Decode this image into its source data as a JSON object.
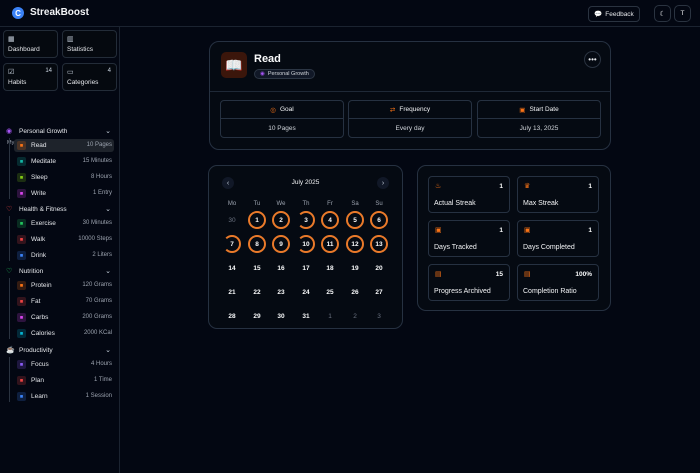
{
  "app": {
    "name": "StreakBoost",
    "feedback": "Feedback",
    "user_initial": "T",
    "theme_icon": "moon-icon"
  },
  "sidebar": {
    "cards": [
      {
        "label": "Dashboard",
        "count": ""
      },
      {
        "label": "Statistics",
        "count": ""
      },
      {
        "label": "Habits",
        "count": "14"
      },
      {
        "label": "Categories",
        "count": "4"
      }
    ],
    "section_title": "My Habits",
    "groups": [
      {
        "name": "Personal Growth",
        "color": "#a855f7",
        "items": [
          {
            "name": "Read",
            "value": "10 Pages",
            "color": "#f97316"
          },
          {
            "name": "Meditate",
            "value": "15 Minutes",
            "color": "#14b8a6"
          },
          {
            "name": "Sleep",
            "value": "8 Hours",
            "color": "#84cc16"
          },
          {
            "name": "Write",
            "value": "1 Entry",
            "color": "#d946ef"
          }
        ]
      },
      {
        "name": "Health & Fitness",
        "color": "#ef4444",
        "items": [
          {
            "name": "Exercise",
            "value": "30 Minutes",
            "color": "#22c55e"
          },
          {
            "name": "Walk",
            "value": "10000 Steps",
            "color": "#ef4444"
          },
          {
            "name": "Drink",
            "value": "2 Liters",
            "color": "#3b82f6"
          }
        ]
      },
      {
        "name": "Nutrition",
        "color": "#22c55e",
        "items": [
          {
            "name": "Protein",
            "value": "120 Grams",
            "color": "#f97316"
          },
          {
            "name": "Fat",
            "value": "70 Grams",
            "color": "#ef4444"
          },
          {
            "name": "Carbs",
            "value": "200 Grams",
            "color": "#d946ef"
          },
          {
            "name": "Calories",
            "value": "2000 KCal",
            "color": "#06b6d4"
          }
        ]
      },
      {
        "name": "Productivity",
        "color": "#eab308",
        "items": [
          {
            "name": "Focus",
            "value": "4 Hours",
            "color": "#8b5cf6"
          },
          {
            "name": "Plan",
            "value": "1 Time",
            "color": "#ef4444"
          },
          {
            "name": "Learn",
            "value": "1 Session",
            "color": "#3b82f6"
          }
        ]
      }
    ]
  },
  "habit": {
    "title": "Read",
    "category": "Personal Growth",
    "menu": "•••",
    "info": [
      {
        "label": "Goal",
        "value": "10 Pages",
        "icon": "target-icon"
      },
      {
        "label": "Frequency",
        "value": "Every day",
        "icon": "repeat-icon"
      },
      {
        "label": "Start Date",
        "value": "July 13, 2025",
        "icon": "calendar-icon"
      }
    ]
  },
  "calendar": {
    "month": "July 2025",
    "prev": "‹",
    "next": "›",
    "weekdays": [
      "Mo",
      "Tu",
      "We",
      "Th",
      "Fr",
      "Sa",
      "Su"
    ],
    "days": [
      "30",
      "1",
      "2",
      "3",
      "4",
      "5",
      "6",
      "7",
      "8",
      "9",
      "10",
      "11",
      "12",
      "13",
      "14",
      "15",
      "16",
      "17",
      "18",
      "19",
      "20",
      "21",
      "22",
      "23",
      "24",
      "25",
      "26",
      "27",
      "28",
      "29",
      "30",
      "31",
      "1",
      "2",
      "3"
    ],
    "muted": [
      0,
      32,
      33,
      34
    ],
    "full_ring": [
      1,
      2,
      4,
      5,
      6,
      8,
      9,
      11,
      12,
      13
    ],
    "partial_ring": [
      3,
      7,
      10
    ]
  },
  "stats": [
    {
      "label": "Actual Streak",
      "value": "1",
      "icon": "flame-icon"
    },
    {
      "label": "Max Streak",
      "value": "1",
      "icon": "crown-icon"
    },
    {
      "label": "Days Tracked",
      "value": "1",
      "icon": "calendar-icon"
    },
    {
      "label": "Days Completed",
      "value": "1",
      "icon": "calendar-check-icon"
    },
    {
      "label": "Progress Archived",
      "value": "15",
      "icon": "archive-icon"
    },
    {
      "label": "Completion Ratio",
      "value": "100%",
      "icon": "clipboard-check-icon"
    }
  ]
}
